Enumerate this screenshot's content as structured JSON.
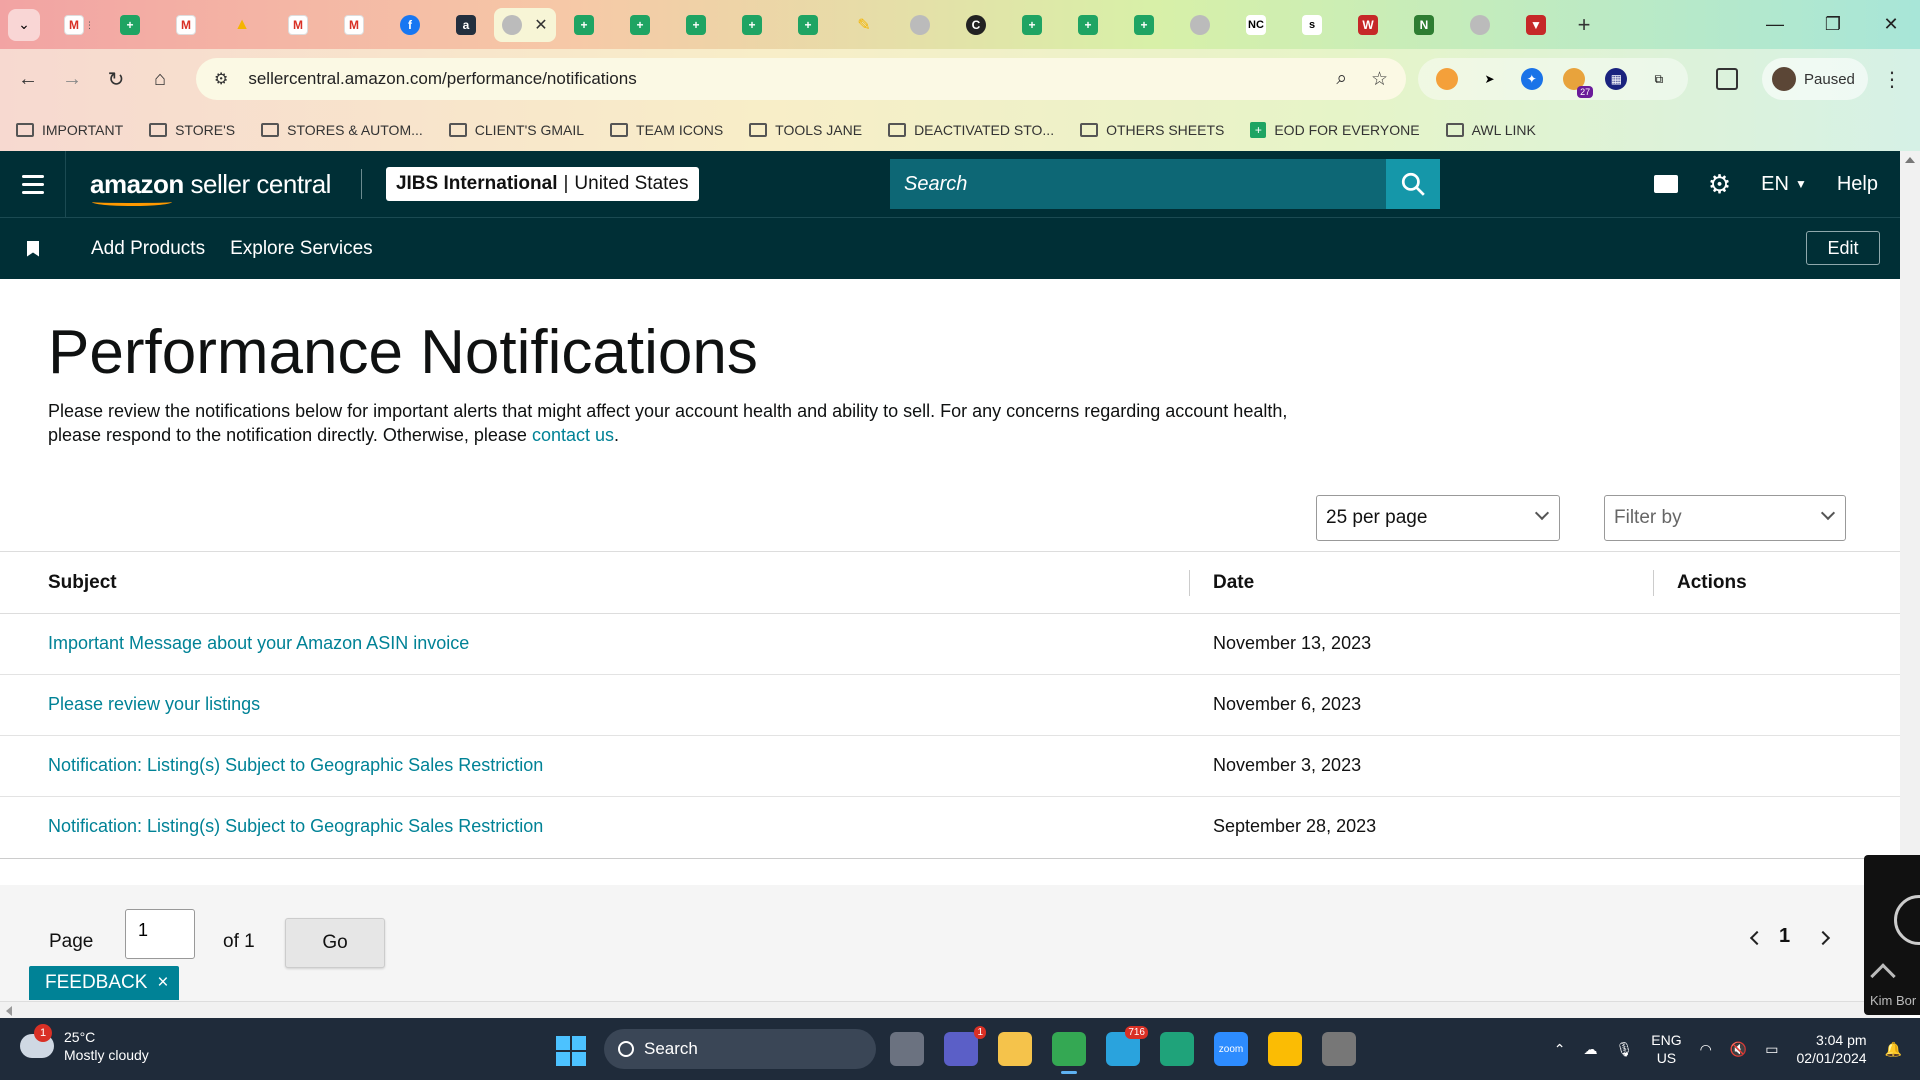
{
  "browser": {
    "url": "sellercentral.amazon.com/performance/notifications",
    "profile_label": "Paused",
    "extension_badge": "27"
  },
  "bookmarks": [
    {
      "label": "IMPORTANT",
      "icon": "folder-icon"
    },
    {
      "label": "STORE'S",
      "icon": "folder-icon"
    },
    {
      "label": "STORES & AUTOM...",
      "icon": "folder-icon"
    },
    {
      "label": "CLIENT'S GMAIL",
      "icon": "folder-icon"
    },
    {
      "label": "TEAM ICONS",
      "icon": "folder-icon"
    },
    {
      "label": "TOOLS JANE",
      "icon": "folder-icon"
    },
    {
      "label": "DEACTIVATED STO...",
      "icon": "folder-icon"
    },
    {
      "label": "OTHERS SHEETS",
      "icon": "folder-icon"
    },
    {
      "label": "EOD FOR EVERYONE",
      "icon": "sheets-icon"
    },
    {
      "label": "AWL LINK",
      "icon": "folder-icon"
    }
  ],
  "header": {
    "logo_brand": "amazon",
    "logo_product": "seller central",
    "account_name": "JIBS International",
    "account_region": "United States",
    "search_placeholder": "Search",
    "language": "EN",
    "help_label": "Help"
  },
  "nav": {
    "add_products": "Add Products",
    "explore_services": "Explore Services",
    "edit_label": "Edit"
  },
  "page": {
    "title": "Performance Notifications",
    "intro_text": "Please review the notifications below for important alerts that might affect your account health and ability to sell. For any concerns regarding account health, please respond to the notification directly. Otherwise, please ",
    "intro_link": "contact us",
    "intro_end": ".",
    "per_page": "25 per page",
    "filter_placeholder": "Filter by"
  },
  "table": {
    "headers": {
      "subject": "Subject",
      "date": "Date",
      "actions": "Actions"
    },
    "rows": [
      {
        "subject": "Important Message about your Amazon ASIN invoice",
        "date": "November 13, 2023"
      },
      {
        "subject": "Please review your listings",
        "date": "November 6, 2023"
      },
      {
        "subject": "Notification: Listing(s) Subject to Geographic Sales Restriction",
        "date": "November 3, 2023"
      },
      {
        "subject": "Notification: Listing(s) Subject to Geographic Sales Restriction",
        "date": "September 28, 2023"
      }
    ]
  },
  "pager": {
    "page_label": "Page",
    "page_value": "1",
    "of_label": "of 1",
    "go_label": "Go",
    "current_page": "1"
  },
  "feedback": {
    "label": "FEEDBACK",
    "close": "×"
  },
  "float_widget": {
    "name": "Kim Bor"
  },
  "taskbar": {
    "temperature": "25°C",
    "weather": "Mostly cloudy",
    "weather_badge": "1",
    "search_label": "Search",
    "teams_badge": "1",
    "telegram_badge": "716",
    "lang_top": "ENG",
    "lang_bottom": "US",
    "time": "3:04 pm",
    "date": "02/01/2024"
  },
  "colors": {
    "header_bg": "#002f36",
    "link": "#008296",
    "search_btn": "#1597a9"
  }
}
